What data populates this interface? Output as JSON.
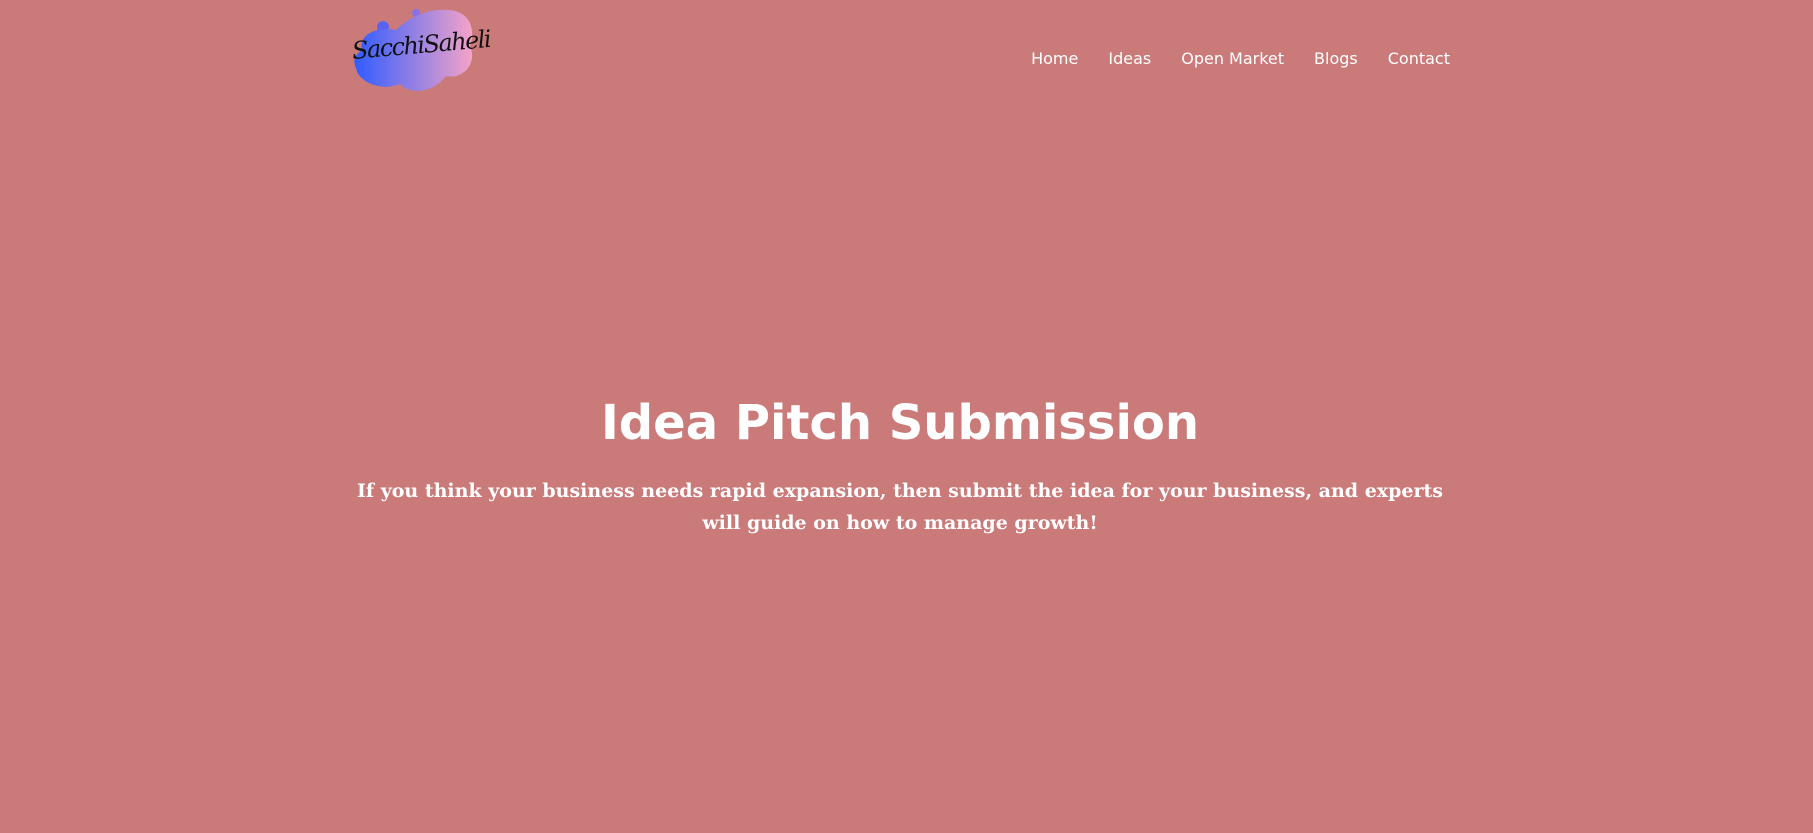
{
  "brand": {
    "logo_text": "SacchiSaheli",
    "gradient_start": "#2f5cff",
    "gradient_end": "#f4a3c8"
  },
  "nav": {
    "items": [
      {
        "label": "Home"
      },
      {
        "label": "Ideas"
      },
      {
        "label": "Open Market"
      },
      {
        "label": "Blogs"
      },
      {
        "label": "Contact"
      }
    ]
  },
  "hero": {
    "title": "Idea Pitch Submission",
    "subtitle": "If you think your business needs rapid expansion, then submit the idea for your business, and experts will guide on how to manage growth!"
  },
  "colors": {
    "background": "#cb7a7a",
    "text": "#ffffff"
  }
}
